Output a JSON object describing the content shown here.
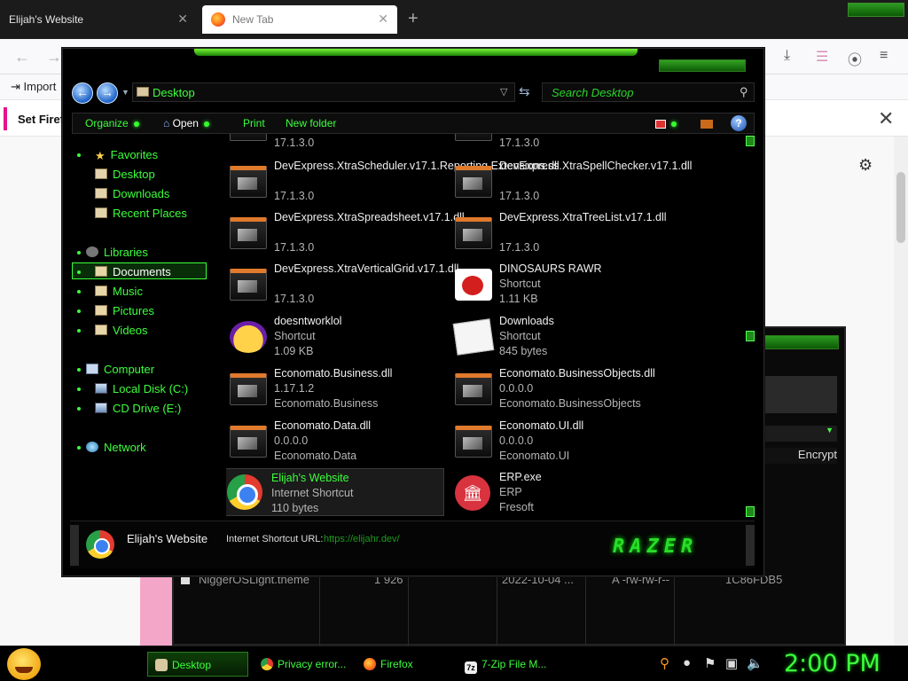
{
  "browser": {
    "tabs": [
      {
        "title": "Elijah's Website"
      },
      {
        "title": "New Tab"
      }
    ],
    "bookmark_import": "Import",
    "notice": "Set Firef",
    "sevenzip": {
      "encrypt_label": "Encrypt",
      "row": {
        "name": "NiggerOSLight.theme",
        "size": "1 926",
        "modified": "2022-10-04 ...",
        "attrib": "A -rw-rw-r--",
        "crc": "1C86FDB5"
      }
    }
  },
  "explorer": {
    "address": "Desktop",
    "search_placeholder": "Search Desktop",
    "commands": {
      "organize": "Organize",
      "open": "Open",
      "print": "Print",
      "new_folder": "New folder"
    },
    "nav": {
      "favorites": "Favorites",
      "desktop": "Desktop",
      "downloads": "Downloads",
      "recent": "Recent Places",
      "libraries": "Libraries",
      "documents": "Documents",
      "music": "Music",
      "pictures": "Pictures",
      "videos": "Videos",
      "computer": "Computer",
      "local_disk": "Local Disk (C:)",
      "cd_drive": "CD Drive (E:)",
      "network": "Network"
    },
    "files": [
      {
        "name": "",
        "line2": "17.1.3.0",
        "line3": ""
      },
      {
        "name": "",
        "line2": "17.1.3.0",
        "line3": ""
      },
      {
        "name": "DevExpress.XtraScheduler.v17.1.Reporting.Extensions.dll",
        "line2": "17.1.3.0",
        "line3": ""
      },
      {
        "name": "DevExpress.XtraSpellChecker.v17.1.dll",
        "line2": "17.1.3.0",
        "line3": ""
      },
      {
        "name": "DevExpress.XtraSpreadsheet.v17.1.dll",
        "line2": "17.1.3.0",
        "line3": ""
      },
      {
        "name": "DevExpress.XtraTreeList.v17.1.dll",
        "line2": "17.1.3.0",
        "line3": ""
      },
      {
        "name": "DevExpress.XtraVerticalGrid.v17.1.dll",
        "line2": "17.1.3.0",
        "line3": ""
      },
      {
        "name": "DINOSAURS RAWR",
        "line2": "Shortcut",
        "line3": "1.11 KB"
      },
      {
        "name": "doesntworklol",
        "line2": "Shortcut",
        "line3": "1.09 KB"
      },
      {
        "name": "Downloads",
        "line2": "Shortcut",
        "line3": "845 bytes"
      },
      {
        "name": "Economato.Business.dll",
        "line2": "1.17.1.2",
        "line3": "Economato.Business"
      },
      {
        "name": "Economato.BusinessObjects.dll",
        "line2": "0.0.0.0",
        "line3": "Economato.BusinessObjects"
      },
      {
        "name": "Economato.Data.dll",
        "line2": "0.0.0.0",
        "line3": "Economato.Data"
      },
      {
        "name": "Economato.UI.dll",
        "line2": "0.0.0.0",
        "line3": "Economato.UI"
      },
      {
        "name": "Elijah's Website",
        "line2": "Internet Shortcut",
        "line3": "110 bytes"
      },
      {
        "name": "ERP.exe",
        "line2": "ERP",
        "line3": "Fresoft"
      }
    ],
    "details": {
      "name": "Elijah's Website",
      "type": "Internet Shortcut URL:",
      "url": "https://elijahr.dev/",
      "logo": "RAZER"
    }
  },
  "taskbar": {
    "items": [
      "Desktop",
      "Privacy error...",
      "Firefox",
      "7-Zip File M..."
    ],
    "clock": "2:00 PM"
  },
  "colors": {
    "accent": "#3cff3c",
    "background": "#000000"
  }
}
